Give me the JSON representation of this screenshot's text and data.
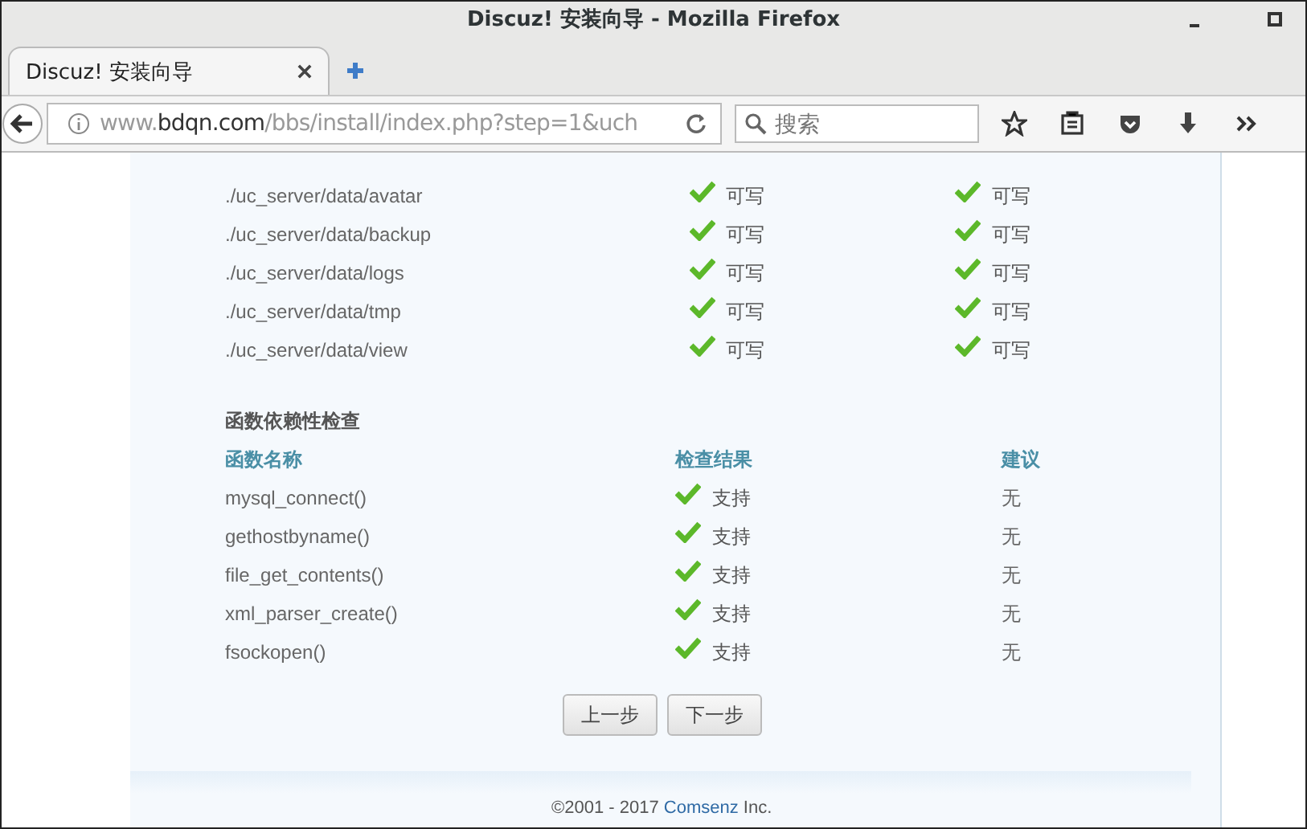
{
  "window": {
    "title": "Discuz! 安装向导  -  Mozilla Firefox"
  },
  "tabs": [
    {
      "label": "Discuz! 安装向导",
      "selected": true
    }
  ],
  "address": {
    "prefix": "www.",
    "domain": "bdqn.com",
    "path": "/bbs/install/index.php?step=1&uch"
  },
  "search": {
    "placeholder": "搜索"
  },
  "directories": [
    {
      "path": "./uc_server/data/avatar",
      "current": {
        "ok": true,
        "text": "可写"
      },
      "required": {
        "ok": true,
        "text": "可写"
      }
    },
    {
      "path": "./uc_server/data/backup",
      "current": {
        "ok": true,
        "text": "可写"
      },
      "required": {
        "ok": true,
        "text": "可写"
      }
    },
    {
      "path": "./uc_server/data/logs",
      "current": {
        "ok": true,
        "text": "可写"
      },
      "required": {
        "ok": true,
        "text": "可写"
      }
    },
    {
      "path": "./uc_server/data/tmp",
      "current": {
        "ok": true,
        "text": "可写"
      },
      "required": {
        "ok": true,
        "text": "可写"
      }
    },
    {
      "path": "./uc_server/data/view",
      "current": {
        "ok": true,
        "text": "可写"
      },
      "required": {
        "ok": true,
        "text": "可写"
      }
    }
  ],
  "function_check": {
    "title": "函数依赖性检查",
    "columns": [
      "函数名称",
      "检查结果",
      "建议"
    ],
    "rows": [
      {
        "name": "mysql_connect()",
        "result": {
          "ok": true,
          "text": "支持"
        },
        "advice": "无"
      },
      {
        "name": "gethostbyname()",
        "result": {
          "ok": true,
          "text": "支持"
        },
        "advice": "无"
      },
      {
        "name": "file_get_contents()",
        "result": {
          "ok": true,
          "text": "支持"
        },
        "advice": "无"
      },
      {
        "name": "xml_parser_create()",
        "result": {
          "ok": true,
          "text": "支持"
        },
        "advice": "无"
      },
      {
        "name": "fsockopen()",
        "result": {
          "ok": true,
          "text": "支持"
        },
        "advice": "无"
      }
    ]
  },
  "buttons": [
    "上一步",
    "下一步"
  ],
  "footer": {
    "before": "©2001 - 2017",
    "link": "Comsenz",
    "after": "Inc."
  }
}
